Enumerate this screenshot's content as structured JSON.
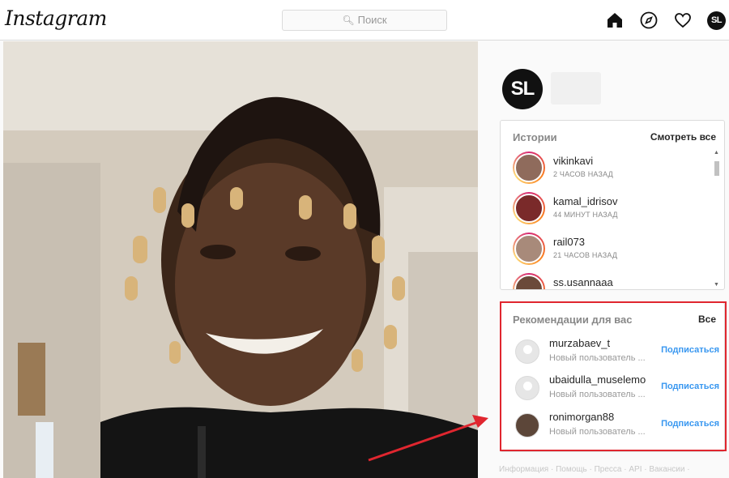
{
  "app": {
    "logo": "Instagram"
  },
  "search": {
    "placeholder": "Поиск"
  },
  "nav": {
    "profile_initials": "SL"
  },
  "profile": {
    "initials": "SL"
  },
  "stories": {
    "title": "Истории",
    "see_all": "Смотреть все",
    "items": [
      {
        "name": "vikinkavi",
        "time": "2 ЧАСОВ НАЗАД"
      },
      {
        "name": "kamal_idrisov",
        "time": "44 МИНУТ НАЗАД"
      },
      {
        "name": "rail073",
        "time": "21 ЧАСОВ НАЗАД"
      },
      {
        "name": "ss.usannaaa",
        "time": ""
      }
    ]
  },
  "recommendations": {
    "title": "Рекомендации для вас",
    "all": "Все",
    "items": [
      {
        "name": "murzabaev_t",
        "sub": "Новый пользователь ...",
        "action": "Подписаться"
      },
      {
        "name": "ubaidulla_muselemo",
        "sub": "Новый пользователь ...",
        "action": "Подписаться"
      },
      {
        "name": "ronimorgan88",
        "sub": "Новый пользователь ...",
        "action": "Подписаться"
      }
    ]
  },
  "footer": {
    "links": "Информация · Помощь · Пресса · API · Вакансии ·"
  },
  "colors": {
    "accent": "#3897f0",
    "highlight": "#e0262f"
  }
}
